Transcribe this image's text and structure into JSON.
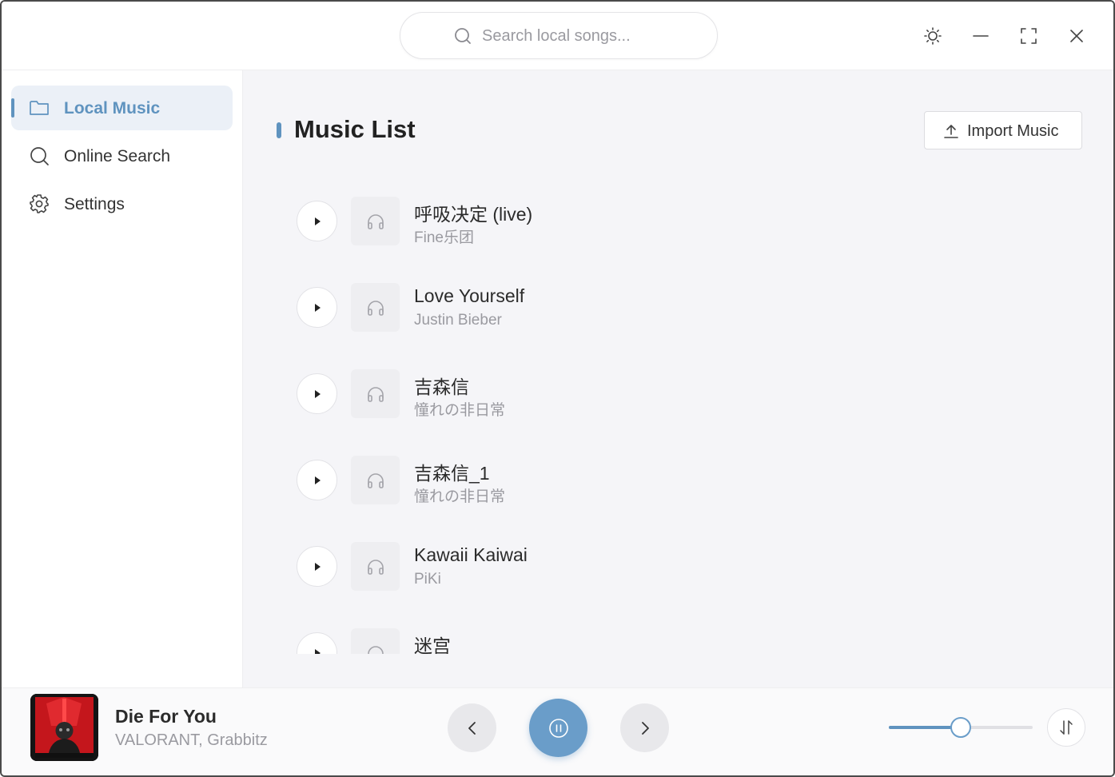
{
  "search": {
    "placeholder": "Search local songs..."
  },
  "window_controls": {
    "theme": "sun-icon",
    "minimize": "minimize-icon",
    "maximize": "fullscreen-icon",
    "close": "close-icon"
  },
  "sidebar": {
    "items": [
      {
        "label": "Local Music",
        "icon": "folder-icon",
        "active": true
      },
      {
        "label": "Online Search",
        "icon": "search-icon",
        "active": false
      },
      {
        "label": "Settings",
        "icon": "gear-icon",
        "active": false
      }
    ]
  },
  "main": {
    "title": "Music List",
    "import_label": "Import Music",
    "songs": [
      {
        "title": "呼吸决定 (live)",
        "artist": "Fine乐团"
      },
      {
        "title": "Love Yourself",
        "artist": "Justin Bieber"
      },
      {
        "title": "吉森信",
        "artist": "憧れの非日常"
      },
      {
        "title": "吉森信_1",
        "artist": "憧れの非日常"
      },
      {
        "title": "Kawaii Kaiwai",
        "artist": "PiKi"
      },
      {
        "title": "迷宫",
        "artist": ""
      }
    ]
  },
  "player": {
    "title": "Die For You",
    "artist": "VALORANT, Grabbitz",
    "volume": 0.5,
    "state": "playing"
  },
  "colors": {
    "accent": "#5f93bf",
    "accent_button": "#6a9dc9",
    "background_main": "#f5f5f8"
  }
}
